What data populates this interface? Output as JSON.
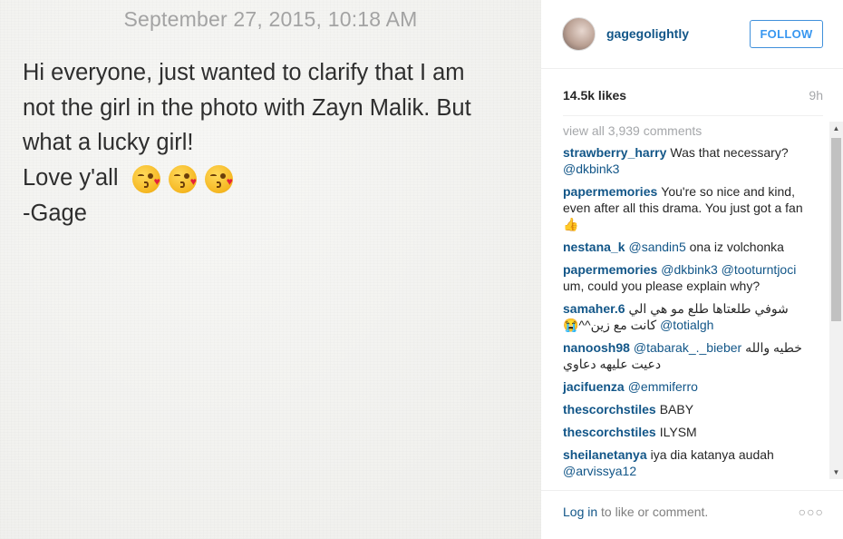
{
  "photo": {
    "date": "September 27, 2015, 10:18 AM",
    "lines": [
      "Hi everyone, just wanted to clarify that I am",
      "not the girl in the photo with Zayn Malik. But",
      "what a lucky girl!",
      "Love y'all",
      "-Gage"
    ],
    "emoji": [
      "face-throwing-kiss-icon",
      "face-throwing-kiss-icon",
      "face-throwing-kiss-icon"
    ]
  },
  "header": {
    "username": "gagegolightly",
    "follow_label": "FOLLOW"
  },
  "stats": {
    "likes": "14.5k likes",
    "time_ago": "9h"
  },
  "comments": {
    "view_all": "view all 3,939 comments",
    "items": [
      {
        "user": "strawberry_harry",
        "text": "Was that necessary?",
        "mention": "@dkbink3"
      },
      {
        "user": "papermemories",
        "text": "You're so nice and kind, even after all this drama. You just got a fan 👍",
        "mention": ""
      },
      {
        "user": "nestana_k",
        "mention_first": "@sandin5",
        "text": "ona iz volchonka"
      },
      {
        "user": "papermemories",
        "mention_first": "@dkbink3 @tooturntjoci",
        "text": "um, could you please explain why?"
      },
      {
        "user": "samaher.6",
        "text": "شوفي طلعتاها طلع مو هي الي كانت مع زين^^😭",
        "mention": "@totialgh"
      },
      {
        "user": "nanoosh98",
        "mention_first": "@tabarak_._bieber",
        "text": "خطيه والله دعيت عليهه دعاوي"
      },
      {
        "user": "jacifuenza",
        "mention_first": "@emmiferro",
        "text": ""
      },
      {
        "user": "thescorchstiles",
        "text": "BABY",
        "mention": ""
      },
      {
        "user": "thescorchstiles",
        "text": "ILYSM",
        "mention": ""
      },
      {
        "user": "sheilanetanya",
        "text": "iya dia katanya audah",
        "mention": "@arvissya12"
      }
    ]
  },
  "footer": {
    "login_link": "Log in",
    "login_suffix": " to like or comment.",
    "more": "○○○"
  },
  "colors": {
    "link": "#125688",
    "follow": "#3897f0",
    "muted": "#a5a7aa"
  }
}
